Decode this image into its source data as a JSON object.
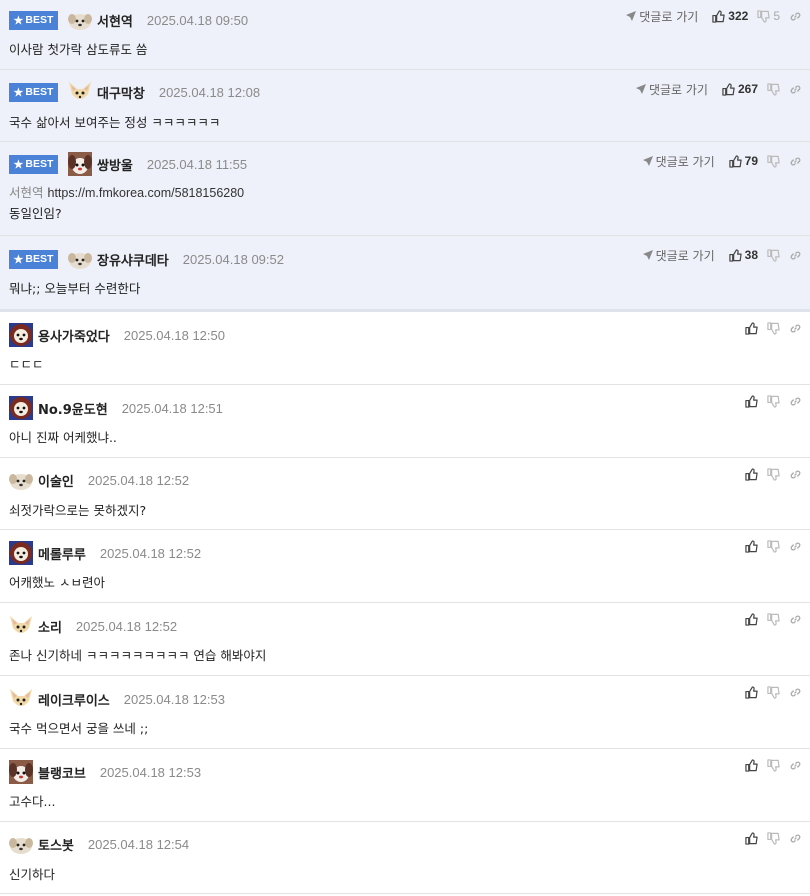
{
  "best_badge": "BEST",
  "reply_label": "댓글로 가기",
  "best_comments": [
    {
      "nick": "서현역",
      "date": "2025.04.18 09:50",
      "text": "이사람 첫가락 삼도류도 씀",
      "up": "322",
      "down": "5",
      "avatar": "puppy-avatar"
    },
    {
      "nick": "대구막창",
      "date": "2025.04.18 12:08",
      "text": "국수 삶아서 보여주는 정성 ㅋㅋㅋㅋㅋㅋ",
      "up": "267",
      "down": "",
      "avatar": "chihuahua-avatar"
    },
    {
      "nick": "쌍방울",
      "date": "2025.04.18 11:55",
      "quote_nick": "서현역",
      "quote_link": "https://m.fmkorea.com/5818156280",
      "text": "동일인임?",
      "up": "79",
      "down": "",
      "avatar": "dog-avatar"
    },
    {
      "nick": "장유샤쿠데타",
      "date": "2025.04.18 09:52",
      "text": "뭐냐;; 오늘부터 수련한다",
      "up": "38",
      "down": "",
      "avatar": "puppy-avatar"
    }
  ],
  "comments": [
    {
      "nick": "용사가죽었다",
      "date": "2025.04.18 12:50",
      "text": "ㄷㄷㄷ",
      "avatar": "lion-avatar"
    },
    {
      "nick": "No.9윤도현",
      "date": "2025.04.18 12:51",
      "text": "아니 진짜 어케했냐..",
      "avatar": "lion-avatar"
    },
    {
      "nick": "이술인",
      "date": "2025.04.18 12:52",
      "text": "쇠젓가락으로는 못하겠지?",
      "avatar": "puppy-avatar"
    },
    {
      "nick": "메롤루루",
      "date": "2025.04.18 12:52",
      "text": "어캐했노 ㅅㅂ련아",
      "avatar": "lion-avatar"
    },
    {
      "nick": "소리",
      "date": "2025.04.18 12:52",
      "text": "존나 신기하네 ㅋㅋㅋㅋㅋㅋㅋㅋㅋ 연습 해봐야지",
      "avatar": "chihuahua-avatar"
    },
    {
      "nick": "레이크루이스",
      "date": "2025.04.18 12:53",
      "text": "국수 먹으면서 궁을 쓰네 ;;",
      "avatar": "chihuahua-avatar"
    },
    {
      "nick": "블랭코브",
      "date": "2025.04.18 12:53",
      "text": "고수다...",
      "avatar": "dog-avatar"
    },
    {
      "nick": "토스봇",
      "date": "2025.04.18 12:54",
      "text": "신기하다",
      "avatar": "puppy-avatar"
    }
  ]
}
